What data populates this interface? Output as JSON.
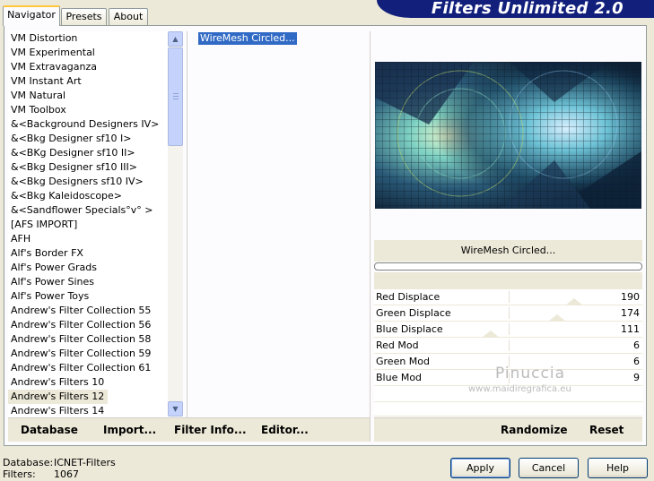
{
  "window": {
    "banner_title": "Filters Unlimited 2.0"
  },
  "tabs": [
    {
      "label": "Navigator",
      "active": true
    },
    {
      "label": "Presets",
      "active": false
    },
    {
      "label": "About",
      "active": false
    }
  ],
  "categories": [
    "VM Distortion",
    "VM Experimental",
    "VM Extravaganza",
    "VM Instant Art",
    "VM Natural",
    "VM Toolbox",
    "&<Background Designers IV>",
    "&<Bkg Designer sf10 I>",
    "&<BKg Designer sf10 II>",
    "&<Bkg Designer sf10 III>",
    "&<Bkg Designers sf10 IV>",
    "&<Bkg Kaleidoscope>",
    "&<Sandflower Specials°v° >",
    "[AFS IMPORT]",
    "AFH",
    "Alf's Border FX",
    "Alf's Power Grads",
    "Alf's Power Sines",
    "Alf's Power Toys",
    "Andrew's Filter Collection 55",
    "Andrew's Filter Collection 56",
    "Andrew's Filter Collection 58",
    "Andrew's Filter Collection 59",
    "Andrew's Filter Collection 61",
    "Andrew's Filters 12",
    "Andrew's Filters 10",
    "Andrew's Filters 14"
  ],
  "categories_display_order": [
    "VM Distortion",
    "VM Experimental",
    "VM Extravaganza",
    "VM Instant Art",
    "VM Natural",
    "VM Toolbox",
    "&<Background Designers IV>",
    "&<Bkg Designer sf10 I>",
    "&<BKg Designer sf10 II>",
    "&<Bkg Designer sf10 III>",
    "&<Bkg Designers sf10 IV>",
    "&<Bkg Kaleidoscope>",
    "&<Sandflower Specials°v° >",
    "[AFS IMPORT]",
    "AFH",
    "Alf's Border FX",
    "Alf's Power Grads",
    "Alf's Power Sines",
    "Alf's Power Toys",
    "Andrew's Filter Collection 55",
    "Andrew's Filter Collection 56",
    "Andrew's Filter Collection 58",
    "Andrew's Filter Collection 59",
    "Andrew's Filter Collection 61",
    "Andrew's Filters 10",
    "Andrew's Filters 12",
    "Andrew's Filters 14"
  ],
  "selected_category": "Andrew's Filters 12",
  "selected_filter": "WireMesh Circled...",
  "filter_name": "WireMesh Circled...",
  "params": [
    {
      "label": "Red Displace",
      "value": "190",
      "level": 0.745
    },
    {
      "label": "Green Displace",
      "value": "174",
      "level": 0.682
    },
    {
      "label": "Blue Displace",
      "value": "111",
      "level": 0.435
    },
    {
      "label": "Red Mod",
      "value": "6"
    },
    {
      "label": "Green Mod",
      "value": "6"
    },
    {
      "label": "Blue Mod",
      "value": "9"
    }
  ],
  "toolbar_left": {
    "database": "Database",
    "import": "Import...",
    "filter_info": "Filter Info...",
    "editor": "Editor..."
  },
  "toolbar_right": {
    "randomize": "Randomize",
    "reset": "Reset"
  },
  "status": {
    "database_label": "Database:",
    "database_value": "ICNET-Filters",
    "filters_label": "Filters:",
    "filters_value": "1067"
  },
  "buttons": {
    "apply": "Apply",
    "cancel": "Cancel",
    "help": "Help"
  },
  "watermark": {
    "name": "Pinuccia",
    "url": "www.maidiregrafica.eu"
  }
}
